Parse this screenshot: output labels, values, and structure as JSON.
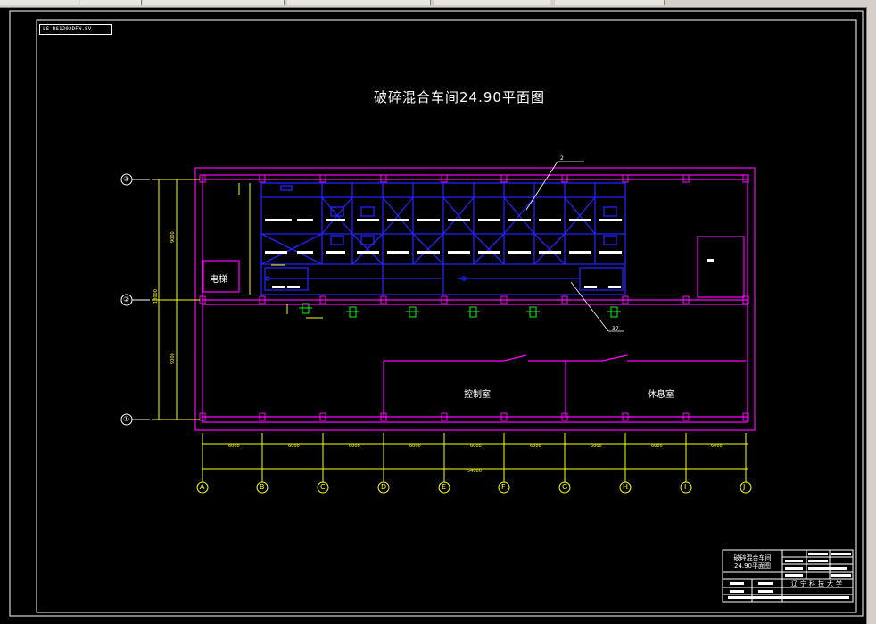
{
  "window": {
    "file_tag": "LS-DS1202DFW.SV"
  },
  "drawing": {
    "title": "破碎混合车间24.90平面图",
    "rooms": {
      "elevator": "电梯",
      "control_room": "控制室",
      "rest_room": "休息室"
    },
    "axis_rows": [
      "③",
      "②",
      "①"
    ],
    "axis_cols": [
      "A",
      "B",
      "C",
      "D",
      "E",
      "F",
      "G",
      "H",
      "I",
      "J"
    ],
    "dim_labels": {
      "span_total": "54000",
      "spans": [
        "6000",
        "6000",
        "6000",
        "6000",
        "6000",
        "6000",
        "6000",
        "6000",
        "6000"
      ],
      "vertical_top": "9000",
      "vertical_bottom": "9000",
      "vertical_total": "18000"
    },
    "callouts": [
      "2",
      "37"
    ]
  },
  "title_block": {
    "drawing_name_line1": "破碎混合车间",
    "drawing_name_line2": "24.90平面图",
    "school": "辽宁科技大学"
  },
  "colors": {
    "background": "#000000",
    "magenta": "#ff00ff",
    "blue": "#1a1aff",
    "yellow": "#ffff00",
    "green": "#00ff00",
    "white": "#ffffff"
  }
}
